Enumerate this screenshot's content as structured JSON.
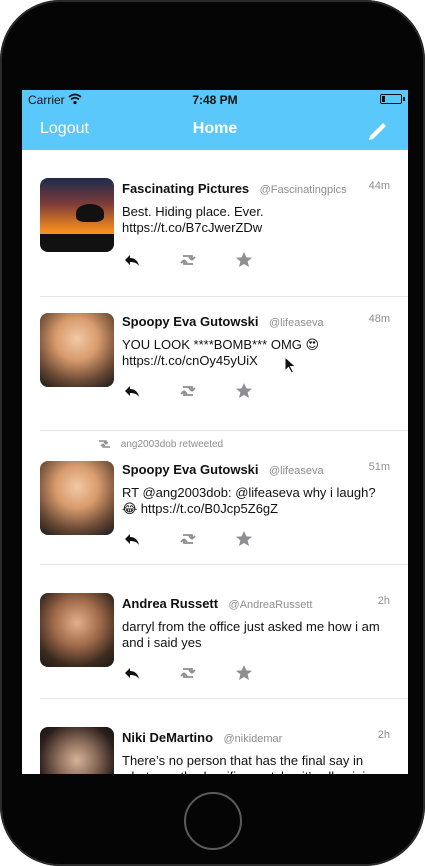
{
  "status": {
    "carrier": "Carrier",
    "time": "7:48 PM"
  },
  "nav": {
    "left_label": "Logout",
    "title": "Home"
  },
  "icons": {
    "compose": "pencil-icon",
    "reply": "reply-icon",
    "retweet": "retweet-icon",
    "favorite": "star-icon"
  },
  "tweets": [
    {
      "name": "Fascinating Pictures",
      "handle": "@Fascinatingpics",
      "time": "44m",
      "text": "Best. Hiding place. Ever. https://t.co/B7cJwerZDw"
    },
    {
      "name": "Spoopy Eva Gutowski",
      "handle": "@lifeaseva",
      "time": "48m",
      "text": "YOU LOOK ****BOMB*** OMG 😍 https://t.co/cnOy45yUiX"
    },
    {
      "retweeted_by": "ang2003dob retweeted",
      "name": "Spoopy Eva Gutowski",
      "handle": "@lifeaseva",
      "time": "51m",
      "text": "RT @ang2003dob: @lifeaseva why i laugh? 😂 https://t.co/B0Jcp5Z6gZ"
    },
    {
      "name": "Andrea Russett",
      "handle": "@AndreaRussett",
      "time": "2h",
      "text": "darryl from the office just asked me how i am and i said yes"
    },
    {
      "name": "Niki DeMartino",
      "handle": "@nikidemar",
      "time": "2h",
      "text": "There’s no person that has the final say in what exactly classifies a style.. it’s all opinion. If you think you’re edgy, you’re"
    }
  ]
}
